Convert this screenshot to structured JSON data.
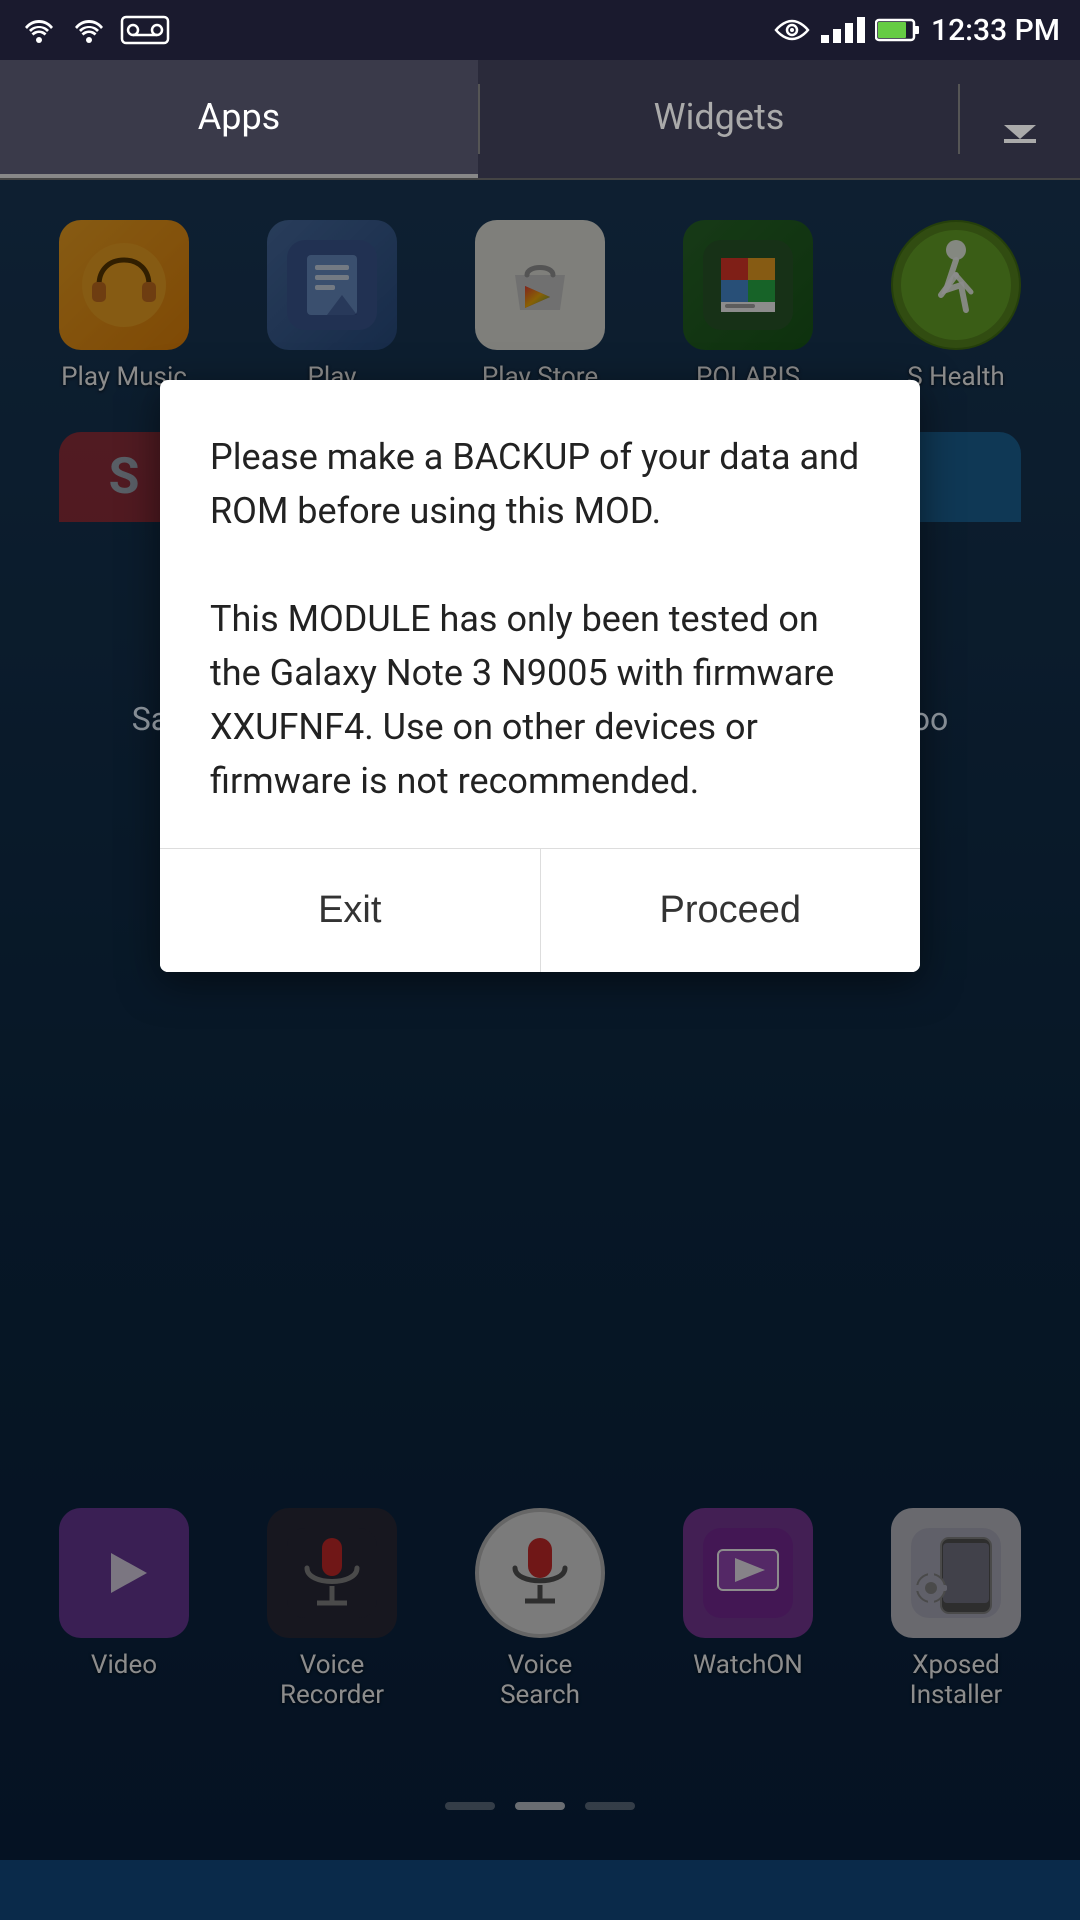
{
  "statusBar": {
    "time": "12:33 PM",
    "batteryLevel": 80
  },
  "tabs": {
    "apps": "Apps",
    "widgets": "Widgets"
  },
  "apps_row1": [
    {
      "id": "play-music",
      "label": "Play Music",
      "iconType": "play-music"
    },
    {
      "id": "play-books",
      "label": "Play",
      "iconType": "play-books"
    },
    {
      "id": "play-store",
      "label": "Play Store",
      "iconType": "play-store"
    },
    {
      "id": "polaris",
      "label": "POLARIS",
      "iconType": "polaris"
    },
    {
      "id": "s-health",
      "label": "S Health",
      "iconType": "s-health"
    }
  ],
  "modal": {
    "message": "Please make a BACKUP of your data and ROM before using this MOD.\n\nThis MODULE has only been tested on the Galaxy Note 3 N9005 with firmware XXUFNF4. Use on other devices or firmware is not recommended.",
    "exitLabel": "Exit",
    "proceedLabel": "Proceed"
  },
  "apps_row_bottom": [
    {
      "id": "video",
      "label": "Video",
      "iconType": "video"
    },
    {
      "id": "voice-recorder",
      "label": "Voice\nRecorder",
      "iconType": "voice-recorder"
    },
    {
      "id": "voice-search",
      "label": "Voice\nSearch",
      "iconType": "voice-search"
    },
    {
      "id": "watchon",
      "label": "WatchON",
      "iconType": "watchon"
    },
    {
      "id": "xposed",
      "label": "Xposed\nInstaller",
      "iconType": "xposed"
    }
  ],
  "pageIndicators": [
    0,
    1,
    2
  ],
  "activeIndicator": 1
}
